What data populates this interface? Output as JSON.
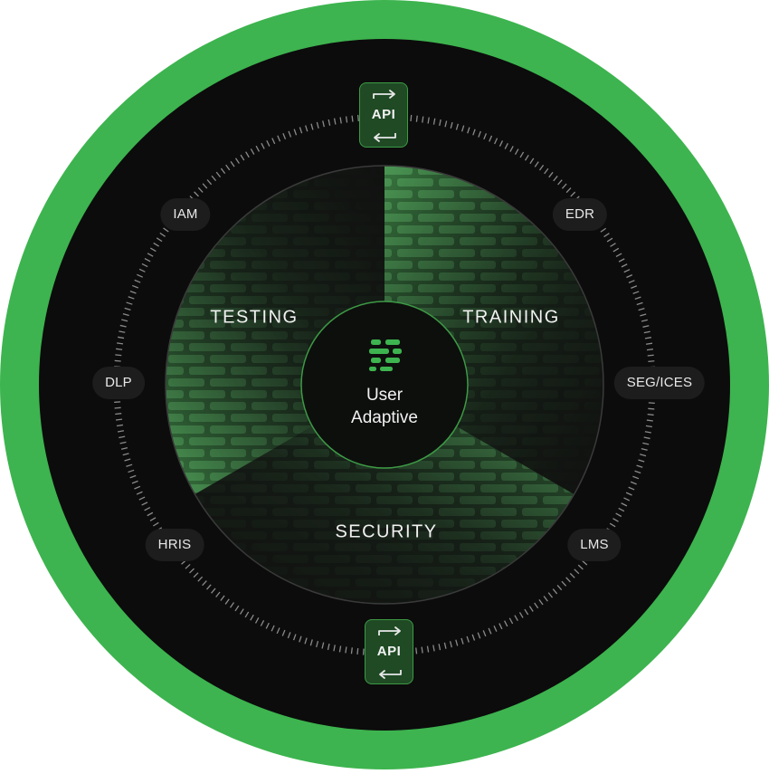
{
  "center": {
    "line1": "User",
    "line2": "Adaptive",
    "icon": "brand-logo-icon"
  },
  "segments": [
    {
      "label": "TESTING"
    },
    {
      "label": "TRAINING"
    },
    {
      "label": "SECURITY"
    }
  ],
  "integrations": [
    {
      "label": "IAM"
    },
    {
      "label": "EDR"
    },
    {
      "label": "DLP"
    },
    {
      "label": "SEG/ICES"
    },
    {
      "label": "HRIS"
    },
    {
      "label": "LMS"
    }
  ],
  "api_top": {
    "label": "API",
    "icon": "sync-arrows-icon"
  },
  "api_bottom": {
    "label": "API",
    "icon": "sync-arrows-icon"
  },
  "colors": {
    "outer_ring": "#3db44f",
    "background": "#0c0c0c",
    "accent": "#3d9a45",
    "api_fill": "#1f4a24",
    "chip_fill": "#1c1d1c"
  }
}
